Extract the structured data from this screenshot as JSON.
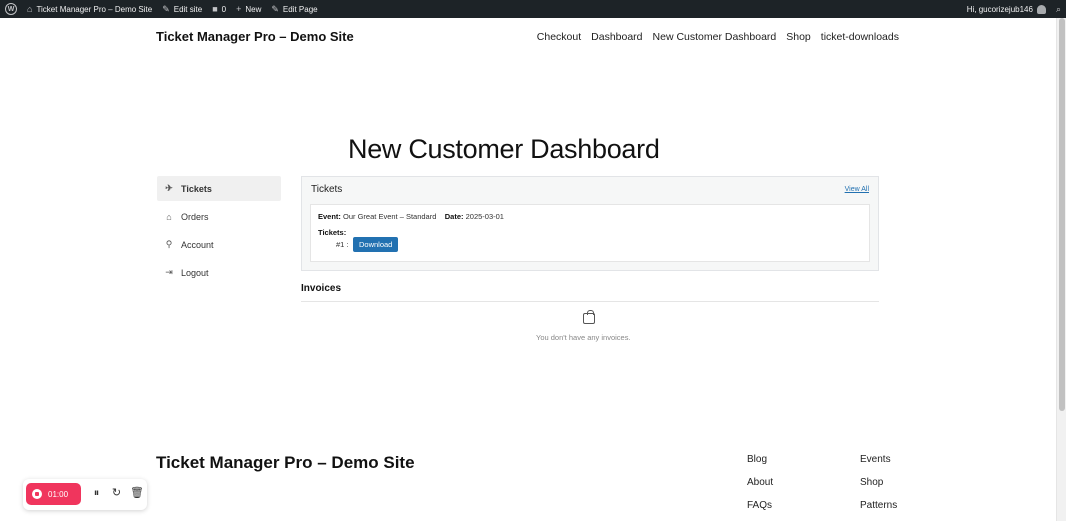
{
  "admin_bar": {
    "site_name": "Ticket Manager Pro – Demo Site",
    "edit_site": "Edit site",
    "comments_count": "0",
    "new_label": "New",
    "edit_page": "Edit Page",
    "greeting": "Hi, gucorizejub146"
  },
  "header": {
    "site_title": "Ticket Manager Pro – Demo Site",
    "nav": [
      "Checkout",
      "Dashboard",
      "New Customer Dashboard",
      "Shop",
      "ticket-downloads"
    ]
  },
  "page_title": "New Customer Dashboard",
  "sidebar": {
    "items": [
      {
        "label": "Tickets",
        "icon": "ticket-icon",
        "active": true
      },
      {
        "label": "Orders",
        "icon": "home-icon",
        "active": false
      },
      {
        "label": "Account",
        "icon": "user-icon",
        "active": false
      },
      {
        "label": "Logout",
        "icon": "logout-icon",
        "active": false
      }
    ]
  },
  "tickets": {
    "title": "Tickets",
    "view_all": "View All",
    "event_label": "Event:",
    "event_value": "Our Great Event – Standard",
    "date_label": "Date:",
    "date_value": "2025-03-01",
    "tickets_label": "Tickets:",
    "ticket_number": "#1 :",
    "download_label": "Download"
  },
  "invoices": {
    "title": "Invoices",
    "empty_text": "You don't have any invoices."
  },
  "footer": {
    "site_title": "Ticket Manager Pro – Demo Site",
    "col1": [
      "Blog",
      "About",
      "FAQs"
    ],
    "col2": [
      "Events",
      "Shop",
      "Patterns"
    ]
  },
  "recorder": {
    "time": "01:00",
    "accent": "#f0355d"
  }
}
